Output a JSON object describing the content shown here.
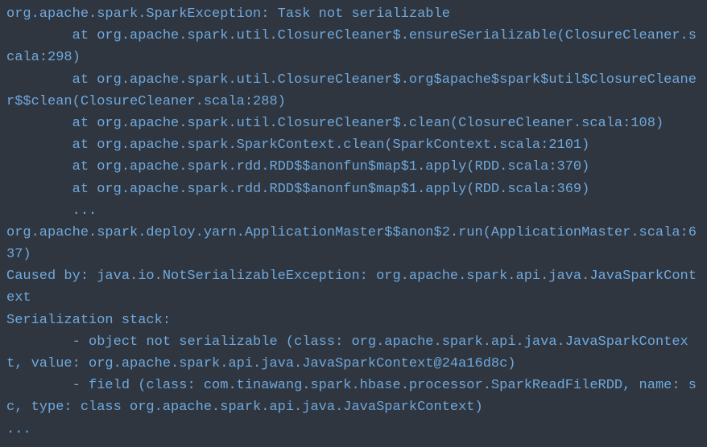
{
  "stacktrace": {
    "line1": "org.apache.spark.SparkException: Task not serializable",
    "line2": "        at org.apache.spark.util.ClosureCleaner$.ensureSerializable(ClosureCleaner.scala:298)",
    "line3": "        at org.apache.spark.util.ClosureCleaner$.org$apache$spark$util$ClosureCleaner$$clean(ClosureCleaner.scala:288)",
    "line4": "        at org.apache.spark.util.ClosureCleaner$.clean(ClosureCleaner.scala:108)",
    "line5": "        at org.apache.spark.SparkContext.clean(SparkContext.scala:2101)",
    "line6": "        at org.apache.spark.rdd.RDD$$anonfun$map$1.apply(RDD.scala:370)",
    "line7": "        at org.apache.spark.rdd.RDD$$anonfun$map$1.apply(RDD.scala:369)",
    "line8": "        ...",
    "line9": "org.apache.spark.deploy.yarn.ApplicationMaster$$anon$2.run(ApplicationMaster.scala:637)",
    "line10": "Caused by: java.io.NotSerializableException: org.apache.spark.api.java.JavaSparkContext",
    "line11": "Serialization stack:",
    "line12": "        - object not serializable (class: org.apache.spark.api.java.JavaSparkContext, value: org.apache.spark.api.java.JavaSparkContext@24a16d8c)",
    "line13": "        - field (class: com.tinawang.spark.hbase.processor.SparkReadFileRDD, name: sc, type: class org.apache.spark.api.java.JavaSparkContext)",
    "line14": "..."
  }
}
